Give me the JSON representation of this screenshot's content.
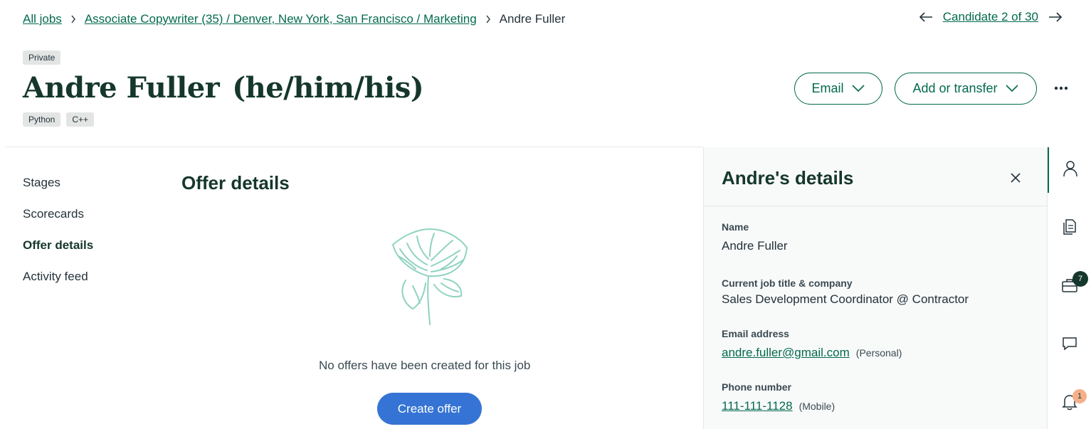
{
  "breadcrumb": {
    "all_jobs": "All jobs",
    "job": "Associate Copywriter (35) / Denver, New York, San Francisco / Marketing",
    "current": "Andre Fuller"
  },
  "candidate_nav": {
    "label": "Candidate 2 of 30"
  },
  "header": {
    "private_badge": "Private",
    "name": "Andre Fuller",
    "pronouns": "(he/him/his)",
    "tags": [
      "Python",
      "C++"
    ],
    "email_button": "Email",
    "transfer_button": "Add or transfer"
  },
  "left_nav": {
    "items": [
      "Stages",
      "Scorecards",
      "Offer details",
      "Activity feed"
    ],
    "active": "Offer details"
  },
  "offer": {
    "heading": "Offer details",
    "empty_message": "No offers have been created for this job",
    "create_button": "Create offer"
  },
  "details_panel": {
    "title": "Andre's details",
    "fields": {
      "name": {
        "label": "Name",
        "value": "Andre Fuller"
      },
      "job": {
        "label": "Current job title & company",
        "value": "Sales Development Coordinator @ Contractor"
      },
      "email": {
        "label": "Email address",
        "value": "andre.fuller@gmail.com",
        "note": "(Personal)"
      },
      "phone": {
        "label": "Phone number",
        "value": "111-111-1128",
        "note": "(Mobile)"
      }
    }
  },
  "rail": {
    "jobs_badge": "7",
    "notifications_badge": "1"
  },
  "colors": {
    "brand_green": "#046a4e",
    "dark_green": "#15372c",
    "primary_blue": "#3574d4",
    "highlight_orange": "#f6a01a",
    "leaf_mint": "#8fd3c0"
  }
}
